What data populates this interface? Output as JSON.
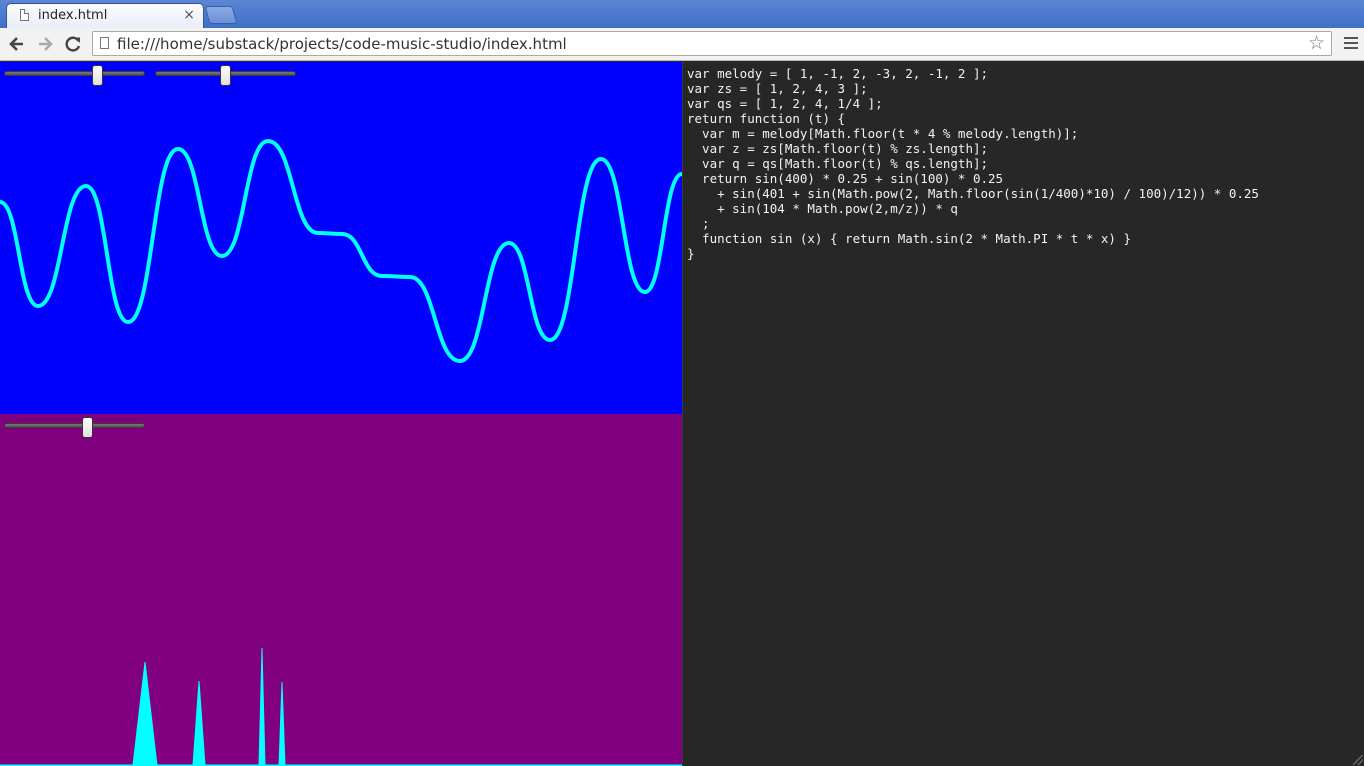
{
  "browser": {
    "tab_title": "index.html",
    "tab_close": "×",
    "url": "file:///home/substack/projects/code-music-studio/index.html",
    "icons": {
      "back": "back-arrow-icon",
      "forward": "forward-arrow-icon",
      "reload": "reload-icon",
      "star": "bookmark-star-icon",
      "menu": "hamburger-menu-icon"
    }
  },
  "colors": {
    "wave_bg": "#0000ff",
    "spectrum_bg": "#800080",
    "trace": "#00ffff",
    "editor_bg": "#272727"
  },
  "controls": {
    "wave_slider_1": 0.68,
    "wave_slider_2": 0.5,
    "spectrum_slider": 0.6
  },
  "code": {
    "lines": [
      "var melody = [ 1, -1, 2, -3, 2, -1, 2 ];",
      "var zs = [ 1, 2, 4, 3 ];",
      "var qs = [ 1, 2, 4, 1/4 ];",
      "return function (t) {",
      "  var m = melody[Math.floor(t * 4 % melody.length)];",
      "  var z = zs[Math.floor(t) % zs.length];",
      "  var q = qs[Math.floor(t) % qs.length];",
      "  return sin(400) * 0.25 + sin(100) * 0.25",
      "    + sin(401 + sin(Math.pow(2, Math.floor(sin(1/400)*10) / 100)/12)) * 0.25",
      "    + sin(104 * Math.pow(2,m/z)) * q",
      "  ;",
      "  function sin (x) { return Math.sin(2 * Math.PI * t * x) }",
      "}"
    ]
  }
}
